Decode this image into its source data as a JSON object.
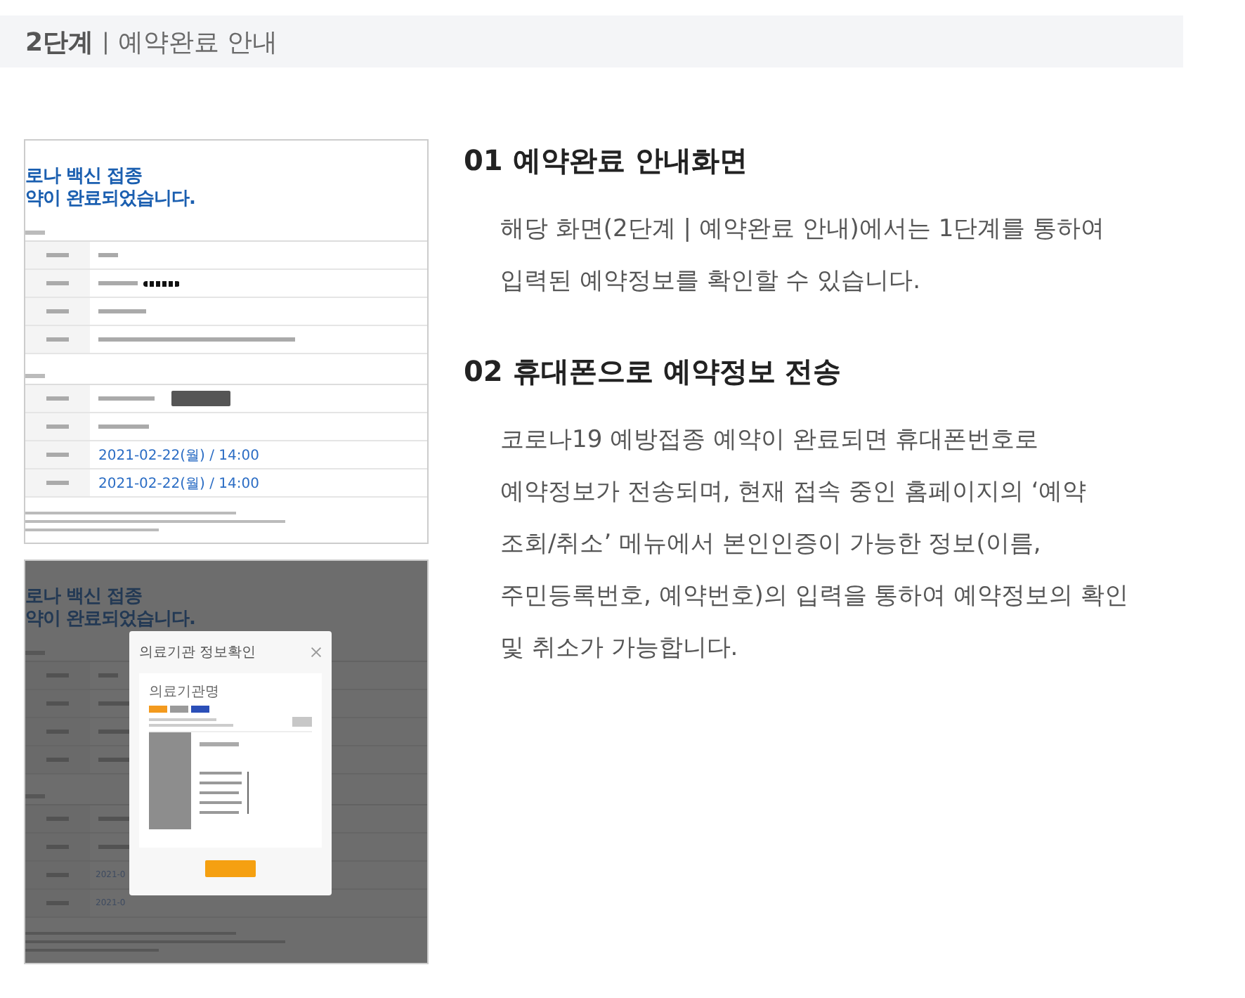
{
  "header": {
    "step": "2단계",
    "separator": "|",
    "title": "예약완료 안내"
  },
  "screenshots": [
    {
      "kind": "plain",
      "title_lines": [
        "로나 백신 접종",
        "약이 완료되었습니다."
      ],
      "dates": [
        "2021-02-22(월) / 14:00",
        "2021-02-22(월) / 14:00"
      ]
    },
    {
      "kind": "modal",
      "title_lines": [
        "로나 백신 접종",
        "약이 완료되었습니다."
      ],
      "dates": [
        "2021-0",
        "2021-0"
      ],
      "modal": {
        "title": "의료기관 정보확인",
        "facility": "의료기관명"
      }
    }
  ],
  "sections": [
    {
      "number": "01",
      "title": "예약완료 안내화면",
      "lines": [
        "해당 화면(2단계 | 예약완료 안내)에서는 1단계를 통하여",
        "입력된 예약정보를 확인할 수 있습니다."
      ]
    },
    {
      "number": "02",
      "title": "휴대폰으로 예약정보 전송",
      "lines": [
        "코로나19 예방접종 예약이 완료되면 휴대폰번호로",
        "예약정보가 전송되며, 현재 접속 중인 홈페이지의 ‘예약",
        "조회/취소’ 메뉴에서 본인인증이 가능한 정보(이름,",
        "주민등록번호, 예약번호)의 입력을 통하여 예약정보의 확인",
        "및 취소가 가능합니다."
      ]
    }
  ]
}
